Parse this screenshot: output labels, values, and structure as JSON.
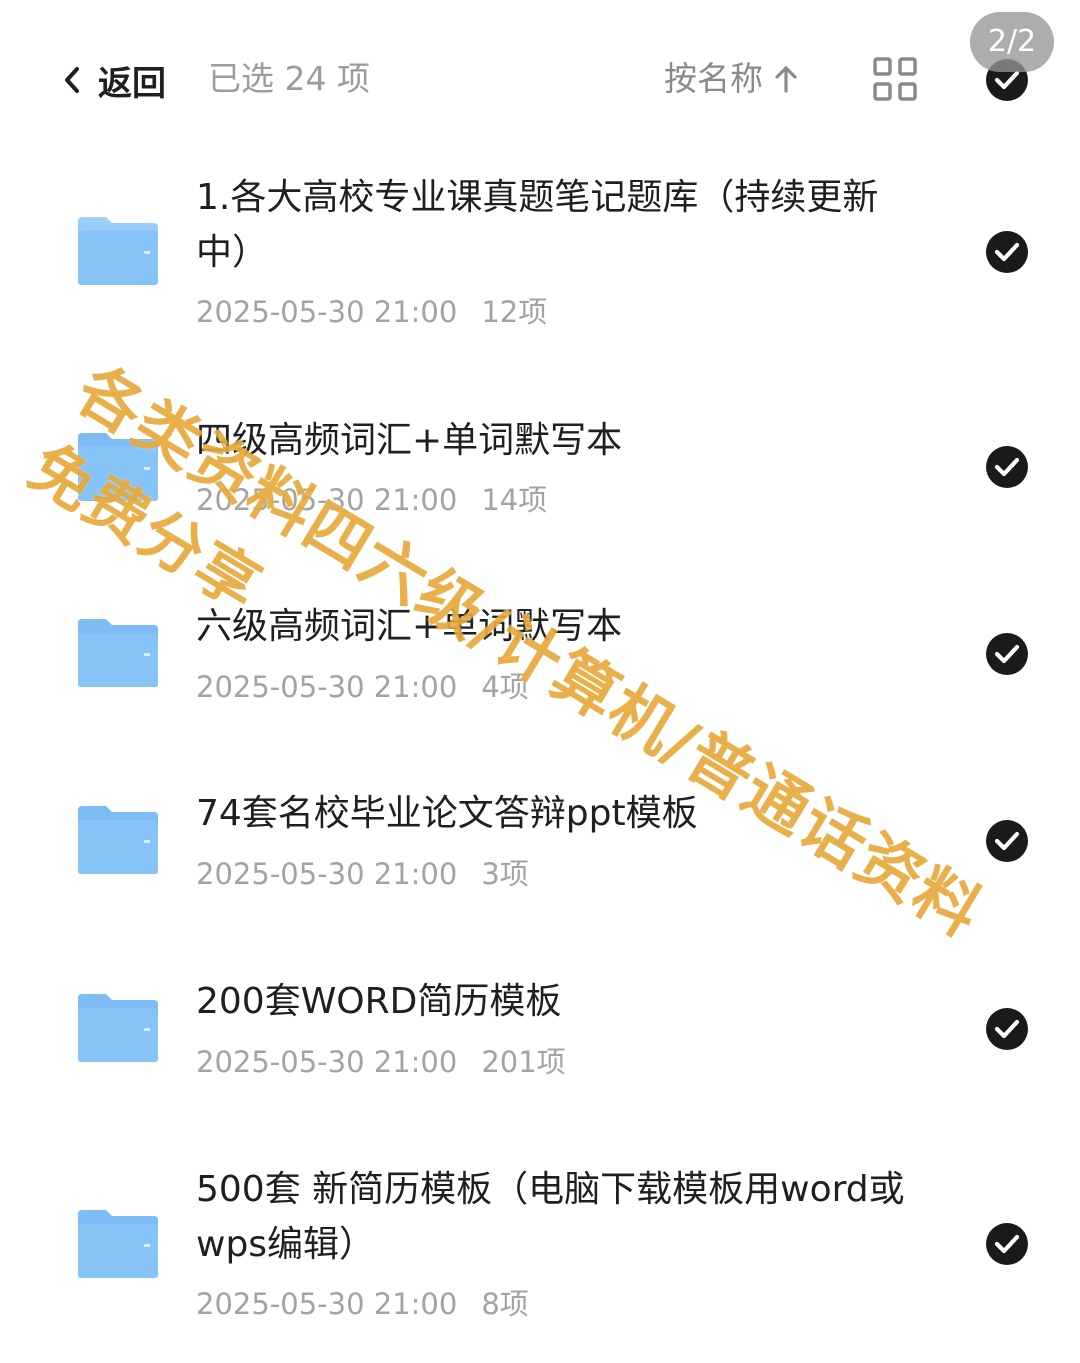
{
  "header": {
    "back_label": "返回",
    "selected_count": "已选 24 项",
    "sort_label": "按名称",
    "page_badge": "2/2"
  },
  "files": [
    {
      "name": "1.各大高校专业课真题笔记题库（持续更新中）",
      "date": "2025-05-30 21:00",
      "count": "12项",
      "selected": true
    },
    {
      "name": "四级高频词汇+单词默写本",
      "date": "2025-05-30 21:00",
      "count": "14项",
      "selected": true
    },
    {
      "name": "六级高频词汇+单词默写本",
      "date": "2025-05-30 21:00",
      "count": "4项",
      "selected": true
    },
    {
      "name": "74套名校毕业论文答辩ppt模板",
      "date": "2025-05-30 21:00",
      "count": "3项",
      "selected": true
    },
    {
      "name": "200套WORD简历模板",
      "date": "2025-05-30 21:00",
      "count": "201项",
      "selected": true
    },
    {
      "name": "500套 新简历模板（电脑下载模板用word或wps编辑）",
      "date": "2025-05-30 21:00",
      "count": "8项",
      "selected": true
    }
  ],
  "watermark": {
    "line1": "各类资料四六级/计算机/普通话资料",
    "line2": "免费分享",
    "color": "#e8a93b"
  },
  "colors": {
    "folder_blue": "#7fc0f5",
    "check_fill": "#1a1a1a",
    "meta_gray": "#a3a3a3"
  }
}
